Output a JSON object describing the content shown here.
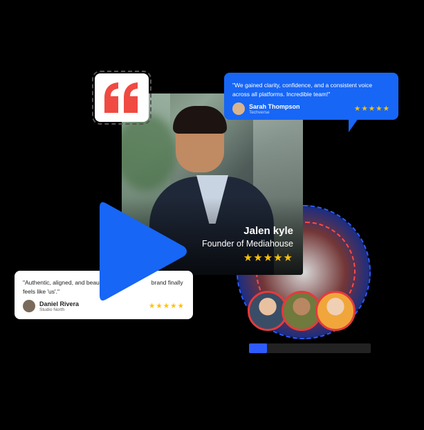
{
  "main_card": {
    "name": "Jalen kyle",
    "role": "Founder of Mediahouse",
    "stars": "★★★★★"
  },
  "review_top": {
    "text": "\"We gained clarity, confidence, and a consistent voice across all platforms. Incredible team!\"",
    "name": "Sarah Thompson",
    "company": "Techverse",
    "stars": "★★★★★"
  },
  "review_bottom": {
    "text_left": "\"Authentic, aligned, and beauti",
    "text_right": "brand finally",
    "text_line2": "feels like 'us'.\"",
    "name": "Daniel Rivera",
    "company": "Studio North",
    "stars": "★★★★★"
  },
  "colors": {
    "accent_blue": "#1766f5",
    "quote_red": "#f04a42",
    "star_yellow": "#ffc107",
    "ring_red": "#e43b3b"
  },
  "icons": [
    "quote-icon",
    "play-icon"
  ]
}
